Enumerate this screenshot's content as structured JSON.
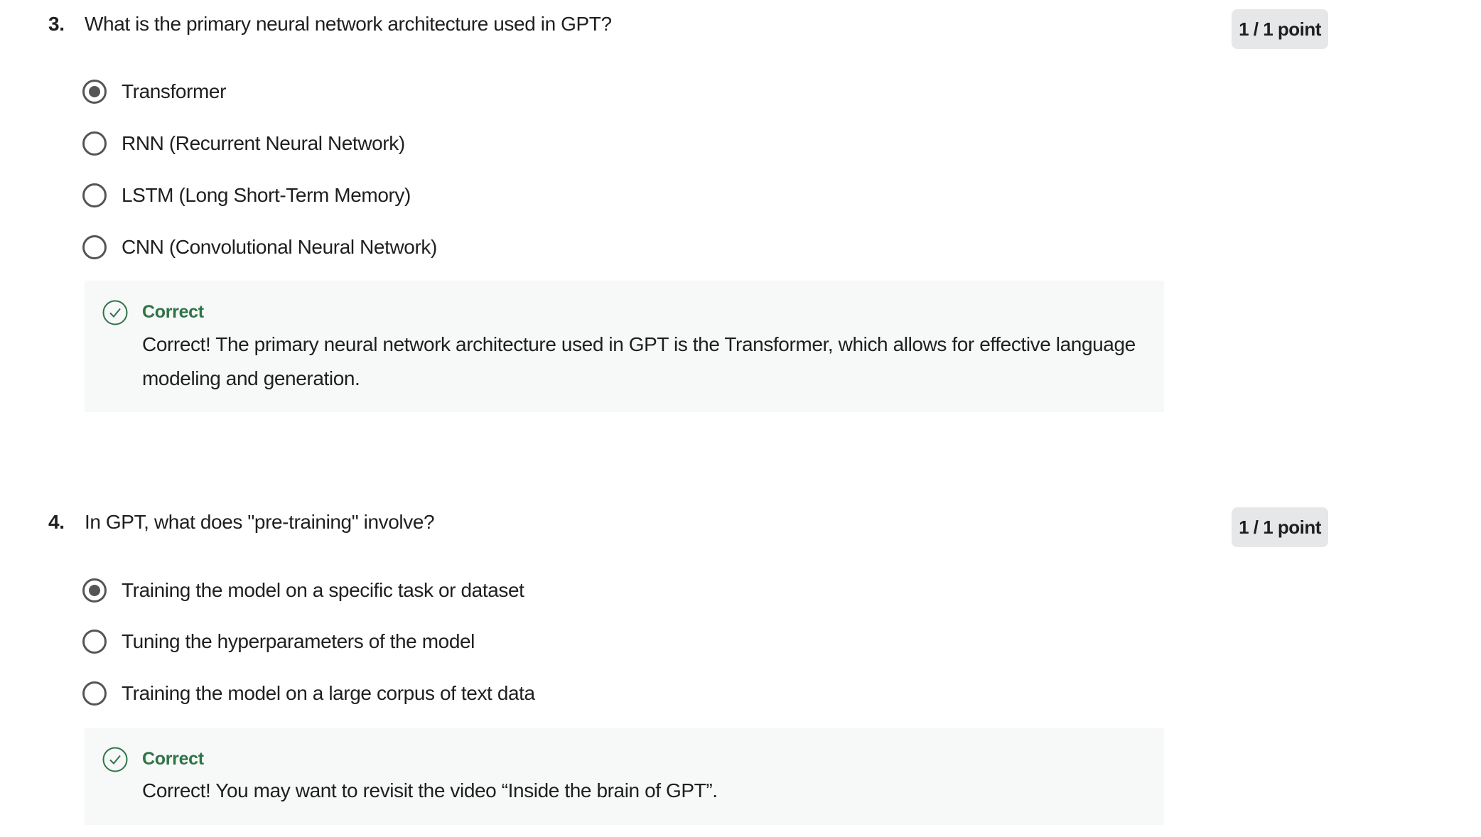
{
  "questions": [
    {
      "number": "3.",
      "text": "What is the primary neural network architecture used in GPT?",
      "score": "1 / 1 point",
      "options": [
        {
          "label": "Transformer",
          "selected": true
        },
        {
          "label": "RNN (Recurrent Neural Network)",
          "selected": false
        },
        {
          "label": "LSTM (Long Short-Term Memory)",
          "selected": false
        },
        {
          "label": "CNN (Convolutional Neural Network)",
          "selected": false
        }
      ],
      "feedback": {
        "icon": "check-circle-icon",
        "title": "Correct",
        "body": "Correct! The primary neural network architecture used in GPT is the Transformer, which allows for effective language modeling and generation."
      }
    },
    {
      "number": "4.",
      "text": "In GPT, what does \"pre-training\" involve?",
      "score": "1 / 1 point",
      "options": [
        {
          "label": "Training the model on a specific task or dataset",
          "selected": true
        },
        {
          "label": "Tuning the hyperparameters of the model",
          "selected": false
        },
        {
          "label": "Training the model on a large corpus of text data",
          "selected": false
        }
      ],
      "feedback": {
        "icon": "check-circle-icon",
        "title": "Correct",
        "body": "Correct! You may want to revisit the video “Inside the brain of GPT”."
      }
    }
  ],
  "colors": {
    "correct": "#2e7447",
    "badge_bg": "#e6e7e9",
    "feedback_bg": "#f7f8f8",
    "radio": "#555555"
  }
}
